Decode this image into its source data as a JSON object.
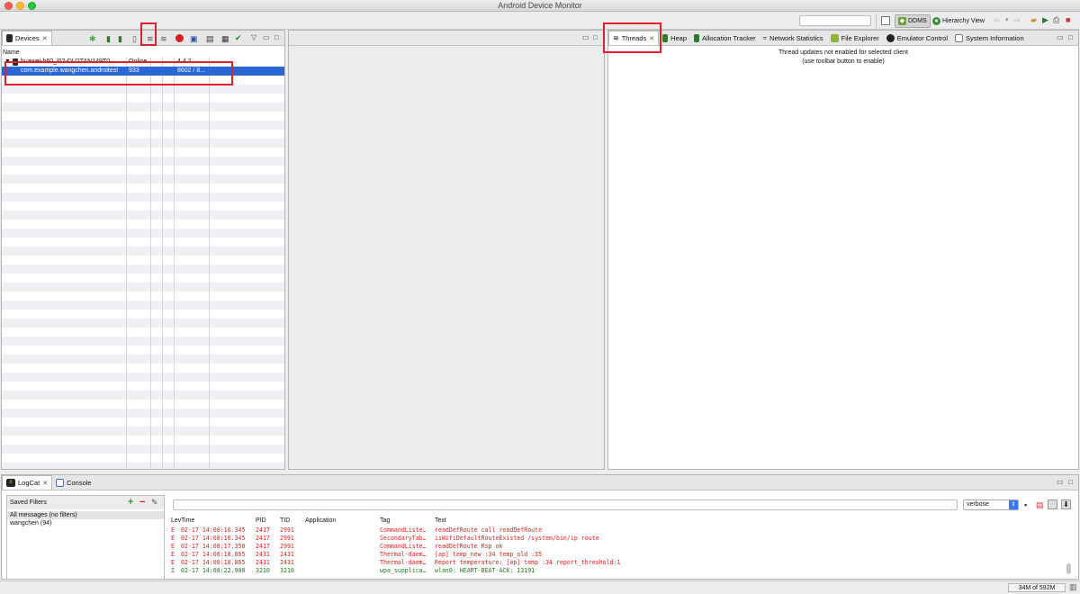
{
  "window": {
    "title": "Android Device Monitor"
  },
  "toolbar": {
    "perspectives": [
      {
        "label": "DDMS"
      },
      {
        "label": "Hierarchy View"
      }
    ]
  },
  "devices_view": {
    "tab_label": "Devices",
    "columns": {
      "name": "Name"
    },
    "device_row": {
      "name": "huawei-h60_l02-DU2TAN149T0",
      "status": "Online",
      "version": "4.4.2"
    },
    "process_row": {
      "name": "com.example.wangchen.androitest",
      "pid": "933",
      "ports": "8602 / 8..."
    }
  },
  "tools_view": {
    "tabs": [
      {
        "label": "Threads",
        "active": true
      },
      {
        "label": "Heap"
      },
      {
        "label": "Allocation Tracker"
      },
      {
        "label": "Network Statistics"
      },
      {
        "label": "File Explorer"
      },
      {
        "label": "Emulator Control"
      },
      {
        "label": "System Information"
      }
    ],
    "message_line1": "Thread updates not enabled for selected client",
    "message_line2": "(use toolbar button to enable)"
  },
  "bottom_tabs": [
    {
      "label": "LogCat",
      "active": true
    },
    {
      "label": "Console"
    }
  ],
  "logcat": {
    "saved_filters_label": "Saved Filters",
    "filters": [
      {
        "label": "All messages (no filters)",
        "selected": true
      },
      {
        "label": "wangchen (94)"
      }
    ],
    "level_select": "verbose",
    "headers": {
      "level": "Lev",
      "time": "Time",
      "pid": "PID",
      "tid": "TID",
      "app": "Application",
      "tag": "Tag",
      "text": "Text"
    },
    "rows": [
      {
        "level": "E",
        "time": "02-17 14:08:16.345",
        "pid": "2417",
        "tid": "2991",
        "tag": "CommandListe…",
        "text": "readDefRoute call readDefRoute",
        "color": "#e02020"
      },
      {
        "level": "E",
        "time": "02-17 14:08:16.345",
        "pid": "2417",
        "tid": "2991",
        "tag": "SecondaryTab…",
        "text": "isWifiDefaultRouteExisted /system/bin/ip route",
        "color": "#e02020"
      },
      {
        "level": "E",
        "time": "02-17 14:08:17.350",
        "pid": "2417",
        "tid": "2991",
        "tag": "CommandListe…",
        "text": "readDefRoute Rsp ok",
        "color": "#e02020"
      },
      {
        "level": "E",
        "time": "02-17 14:08:18.865",
        "pid": "2431",
        "tid": "2431",
        "tag": "Thermal-daem…",
        "text": "[ap] temp_new :34  temp_old :35",
        "color": "#e02020"
      },
      {
        "level": "E",
        "time": "02-17 14:08:18.865",
        "pid": "2431",
        "tid": "2431",
        "tag": "Thermal-daem…",
        "text": "Report temperature: [ap] temp :34  report_threshold:1",
        "color": "#e02020"
      },
      {
        "level": "I",
        "time": "02-17 14:08:22.900",
        "pid": "3210",
        "tid": "3210",
        "tag": "wpa_supplica…",
        "text": "wlan0: HEART-BEAT-ACK: 13191",
        "color": "#1c7a1c"
      }
    ]
  },
  "status": {
    "memory": "34M of 592M"
  },
  "colors": {
    "selection": "#2a66d6",
    "highlight": "#e0202e",
    "error": "#e02020",
    "info": "#1c7a1c"
  }
}
